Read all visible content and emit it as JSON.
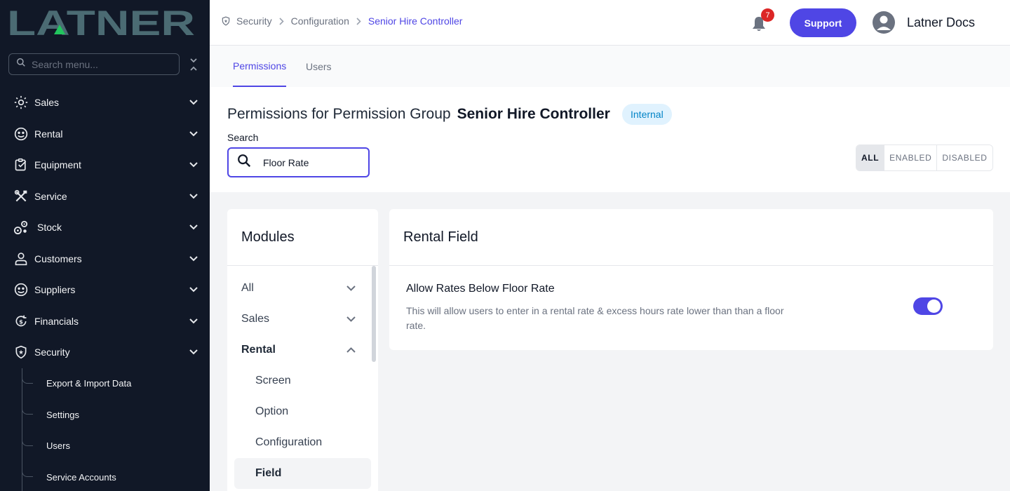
{
  "app": {
    "logo_text": "LATNER",
    "colors": {
      "accent": "#4f46e5",
      "sidebar_bg": "#111827",
      "logo": "#4b6b73",
      "logo_accent": "#22c55e",
      "badge_red": "#dc2626",
      "internal_bg": "#e0f2fe",
      "internal_text": "#0284c7"
    }
  },
  "sidebar": {
    "search_placeholder": "Search menu...",
    "items": [
      {
        "label": "Sales",
        "icon": "sales-icon"
      },
      {
        "label": "Rental",
        "icon": "rental-icon"
      },
      {
        "label": "Equipment",
        "icon": "equipment-icon"
      },
      {
        "label": "Service",
        "icon": "service-icon"
      },
      {
        "label": "Stock",
        "icon": "stock-icon"
      },
      {
        "label": "Customers",
        "icon": "customers-icon"
      },
      {
        "label": "Suppliers",
        "icon": "suppliers-icon"
      },
      {
        "label": "Financials",
        "icon": "financials-icon"
      },
      {
        "label": "Security",
        "icon": "security-icon"
      }
    ],
    "security_sub": [
      "Export & Import Data",
      "Settings",
      "Users",
      "Service Accounts"
    ]
  },
  "header": {
    "breadcrumb": [
      "Security",
      "Configuration",
      "Senior Hire Controller"
    ],
    "notification_count": "7",
    "support_label": "Support",
    "user_name": "Latner Docs"
  },
  "tabs": [
    {
      "label": "Permissions",
      "active": true
    },
    {
      "label": "Users",
      "active": false
    }
  ],
  "title": {
    "prefix": "Permissions for Permission Group",
    "group_name": "Senior Hire Controller",
    "badge": "Internal"
  },
  "search": {
    "label": "Search",
    "value": "Floor Rate"
  },
  "filters": [
    {
      "label": "ALL",
      "active": true
    },
    {
      "label": "ENABLED",
      "active": false
    },
    {
      "label": "DISABLED",
      "active": false
    }
  ],
  "modules": {
    "title": "Modules",
    "items": [
      {
        "label": "All",
        "expanded": false
      },
      {
        "label": "Sales",
        "expanded": false
      },
      {
        "label": "Rental",
        "expanded": true
      }
    ],
    "rental_sub": [
      {
        "label": "Screen",
        "active": false
      },
      {
        "label": "Option",
        "active": false
      },
      {
        "label": "Configuration",
        "active": false
      },
      {
        "label": "Field",
        "active": true
      }
    ]
  },
  "field_panel": {
    "title": "Rental Field",
    "permission": {
      "title": "Allow Rates Below Floor Rate",
      "description": "This will allow users to enter in a rental rate & excess hours rate lower than than a floor rate.",
      "enabled": true
    }
  }
}
